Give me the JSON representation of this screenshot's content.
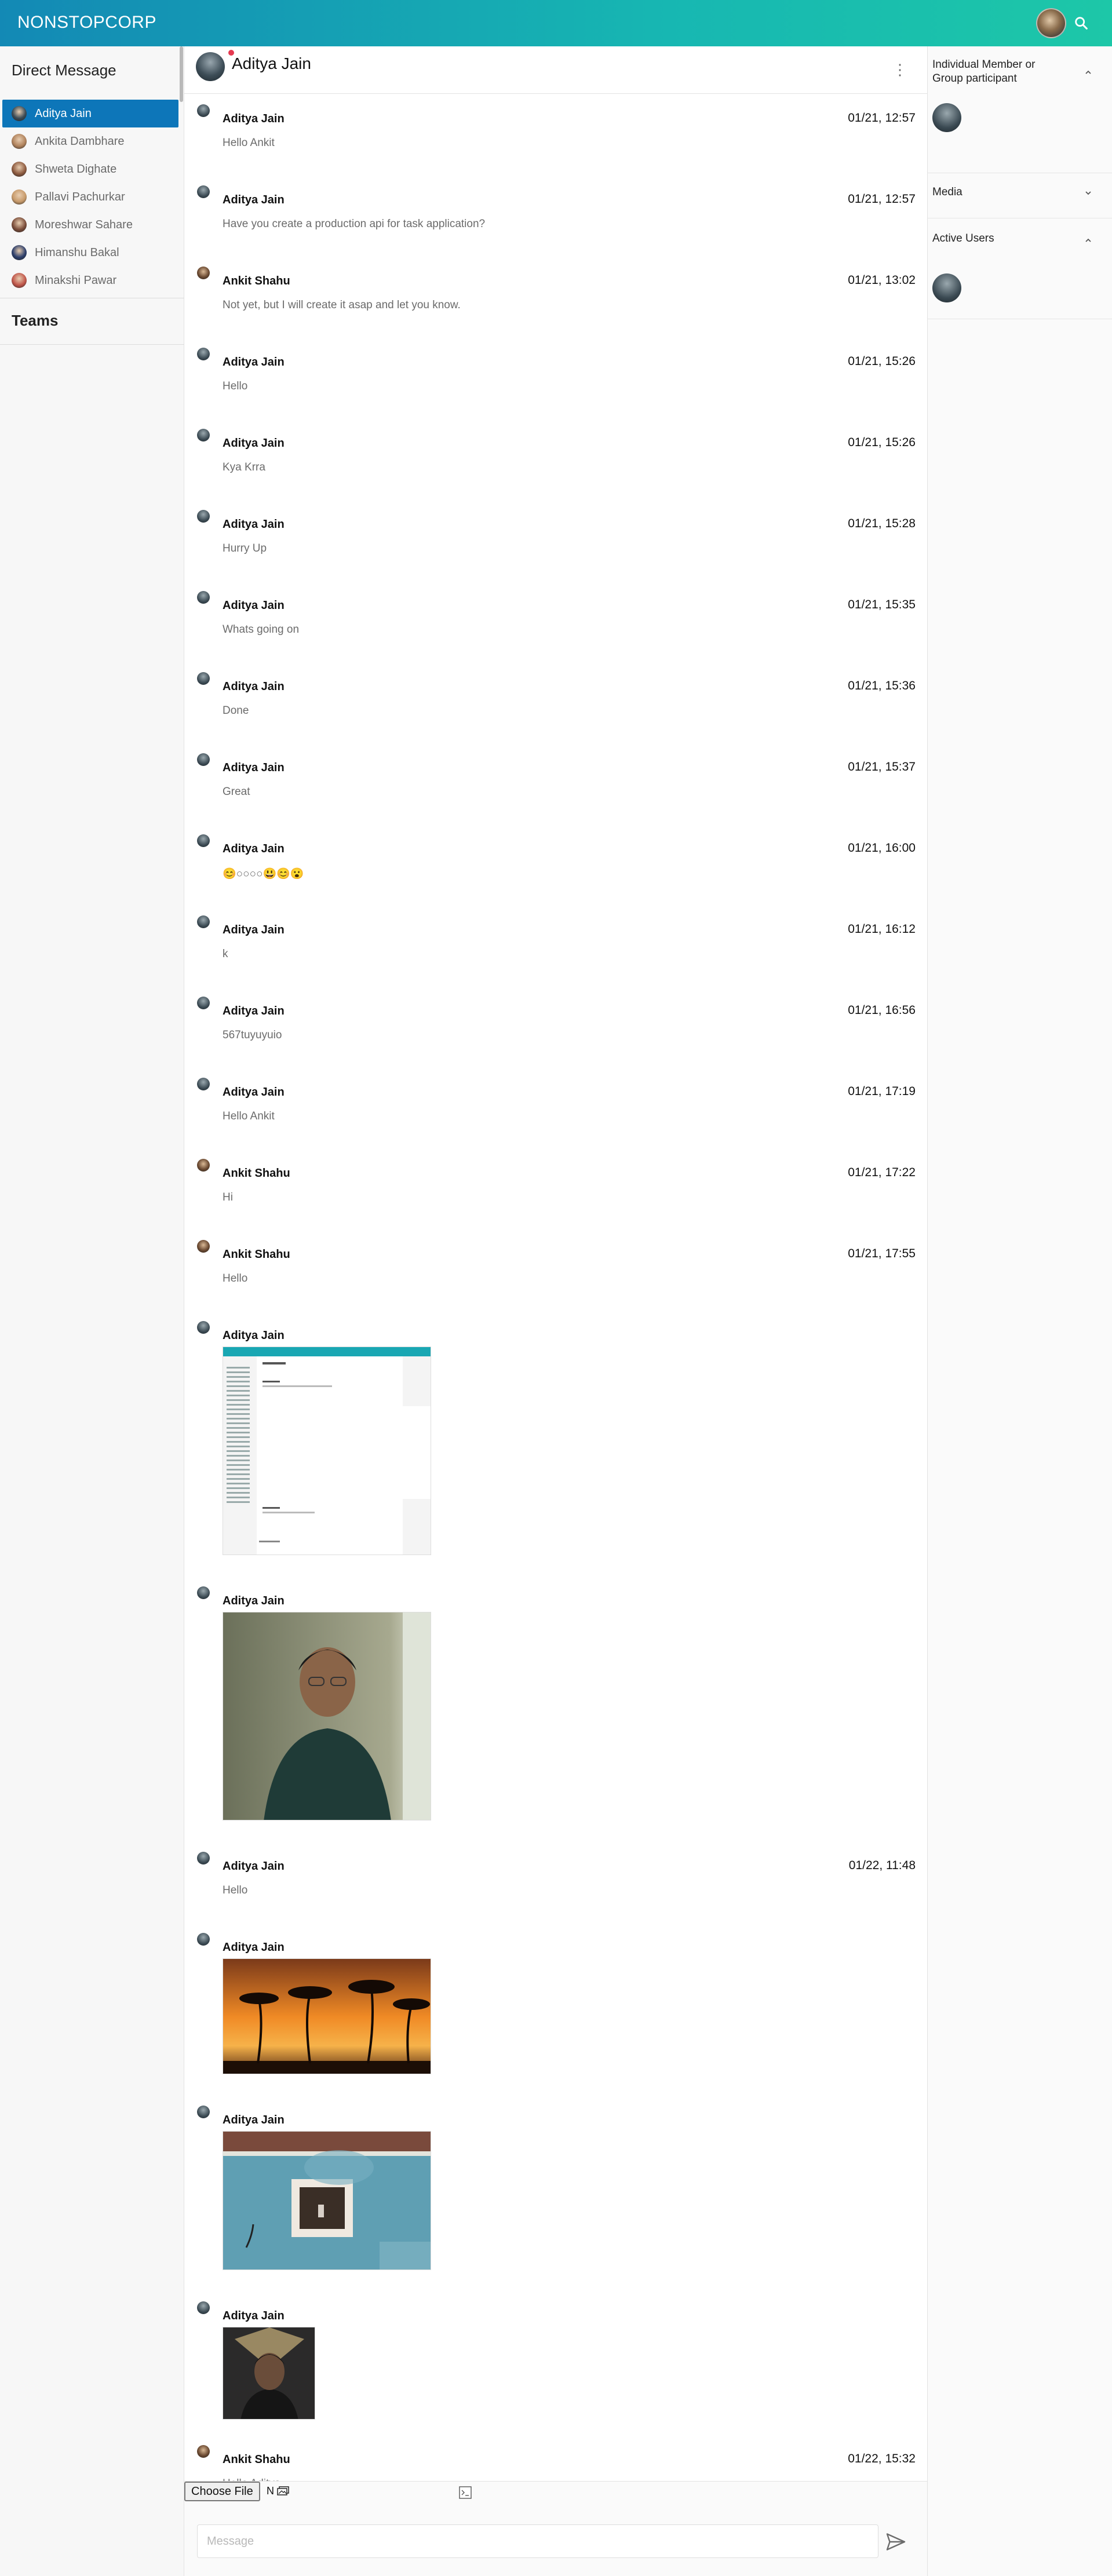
{
  "header": {
    "brand": "NONSTOPCORP"
  },
  "sidebar": {
    "title": "Direct Message",
    "items": [
      {
        "name": "Aditya Jain",
        "active": true,
        "color": "#3a4a55"
      },
      {
        "name": "Ankita Dambhare",
        "active": false,
        "color": "#b0825c"
      },
      {
        "name": "Shweta Dighate",
        "active": false,
        "color": "#8d5a3f"
      },
      {
        "name": "Pallavi Pachurkar",
        "active": false,
        "color": "#c79a6a"
      },
      {
        "name": "Moreshwar Sahare",
        "active": false,
        "color": "#7b4d3a"
      },
      {
        "name": "Himanshu Bakal",
        "active": false,
        "color": "#2c3e6b"
      },
      {
        "name": "Minakshi Pawar",
        "active": false,
        "color": "#c0564a"
      }
    ],
    "teams_label": "Teams"
  },
  "chat": {
    "title": "Aditya Jain",
    "messages": [
      {
        "sender": "Aditya Jain",
        "time": "01/21, 12:57",
        "text": "Hello Ankit"
      },
      {
        "sender": "Aditya Jain",
        "time": "01/21, 12:57",
        "text": "Have you create a production api for task application?"
      },
      {
        "sender": "Ankit Shahu",
        "time": "01/21, 13:02",
        "text": "Not yet, but I will create it asap and let you know."
      },
      {
        "sender": "Aditya Jain",
        "time": "01/21, 15:26",
        "text": "Hello"
      },
      {
        "sender": "Aditya Jain",
        "time": "01/21, 15:26",
        "text": "Kya Krra"
      },
      {
        "sender": "Aditya Jain",
        "time": "01/21, 15:28",
        "text": "Hurry Up"
      },
      {
        "sender": "Aditya Jain",
        "time": "01/21, 15:35",
        "text": "Whats going on"
      },
      {
        "sender": "Aditya Jain",
        "time": "01/21, 15:36",
        "text": "Done"
      },
      {
        "sender": "Aditya Jain",
        "time": "01/21, 15:37",
        "text": "Great"
      },
      {
        "sender": "Aditya Jain",
        "time": "01/21, 16:00",
        "text": "😊○○○○😃😊😮"
      },
      {
        "sender": "Aditya Jain",
        "time": "01/21, 16:12",
        "text": "k"
      },
      {
        "sender": "Aditya Jain",
        "time": "01/21, 16:56",
        "text": "567tuyuyuio"
      },
      {
        "sender": "Aditya Jain",
        "time": "01/21, 17:19",
        "text": "Hello Ankit"
      },
      {
        "sender": "Ankit Shahu",
        "time": "01/21, 17:22",
        "text": "Hi"
      },
      {
        "sender": "Ankit Shahu",
        "time": "01/21, 17:55",
        "text": "Hello"
      },
      {
        "sender": "Aditya Jain",
        "time": "",
        "text": "",
        "image": "screenshot"
      },
      {
        "sender": "Aditya Jain",
        "time": "",
        "text": "",
        "image": "portrait"
      },
      {
        "sender": "Aditya Jain",
        "time": "01/22, 11:48",
        "text": "Hello"
      },
      {
        "sender": "Aditya Jain",
        "time": "",
        "text": "",
        "image": "sunset-palms"
      },
      {
        "sender": "Aditya Jain",
        "time": "",
        "text": "",
        "image": "window-wall"
      },
      {
        "sender": "Aditya Jain",
        "time": "",
        "text": "",
        "image": "portrait-small"
      },
      {
        "sender": "Ankit Shahu",
        "time": "01/22, 15:32",
        "text": "Hello Aditya"
      }
    ]
  },
  "composer": {
    "file_button": "Choose File",
    "file_status": "N",
    "placeholder": "Message"
  },
  "right_panel": {
    "members_title": "Individual Member or Group participant",
    "media_title": "Media",
    "active_users_title": "Active Users"
  },
  "colors": {
    "accent": "#0d76b9",
    "header_start": "#1389b5",
    "header_end": "#1dc7a8",
    "online_dot": "#e53950"
  },
  "icons": [
    "search-icon",
    "kebab-menu-icon",
    "emoji-icon",
    "send-icon",
    "chevron-up-icon",
    "chevron-down-icon",
    "image-upload-icon"
  ]
}
